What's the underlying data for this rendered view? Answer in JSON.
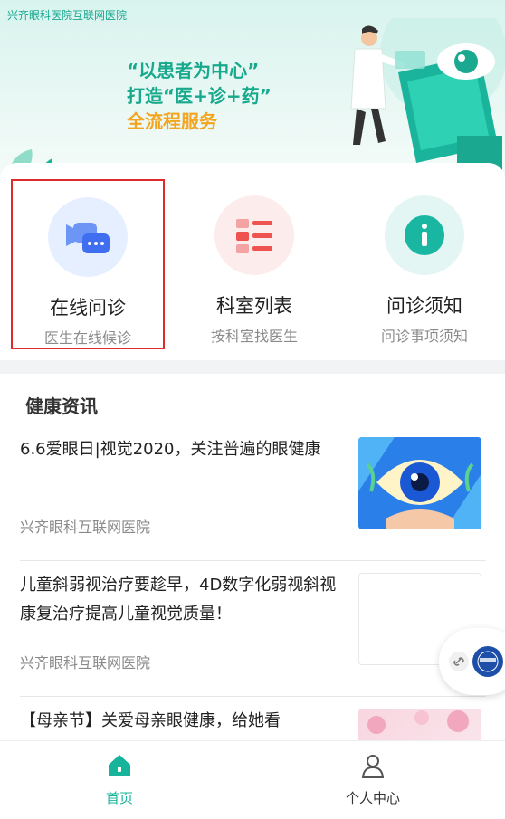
{
  "banner": {
    "hospital_name": "兴齐眼科医院互联网医院",
    "slogan_line1": "“以患者为中心”",
    "slogan_line2": "打造“医+诊+药”",
    "slogan_line3": "全流程服务"
  },
  "quick_entries": [
    {
      "title": "在线问诊",
      "subtitle": "医生在线候诊",
      "icon": "video-chat-icon",
      "color": "#4a7cf0"
    },
    {
      "title": "科室列表",
      "subtitle": "按科室找医生",
      "icon": "list-icon",
      "color": "#ef5350"
    },
    {
      "title": "问诊须知",
      "subtitle": "问诊事项须知",
      "icon": "info-icon",
      "color": "#19b6a2"
    }
  ],
  "news": {
    "section_title": "健康资讯",
    "items": [
      {
        "title": "6.6爱眼日|视觉2020，关注普遍的眼健康",
        "source": "兴齐眼科互联网医院"
      },
      {
        "title": "儿童斜弱视治疗要趁早，4D数字化弱视斜视康复治疗提高儿童视觉质量！",
        "source": "兴齐眼科互联网医院"
      },
      {
        "title": "【母亲节】关爱母亲眼健康，给她看",
        "source": ""
      }
    ]
  },
  "tabbar": {
    "home_label": "首页",
    "me_label": "个人中心"
  },
  "colors": {
    "brand": "#17b39a",
    "highlight_border": "#e02b2b",
    "slogan_orange": "#f3a51f"
  }
}
